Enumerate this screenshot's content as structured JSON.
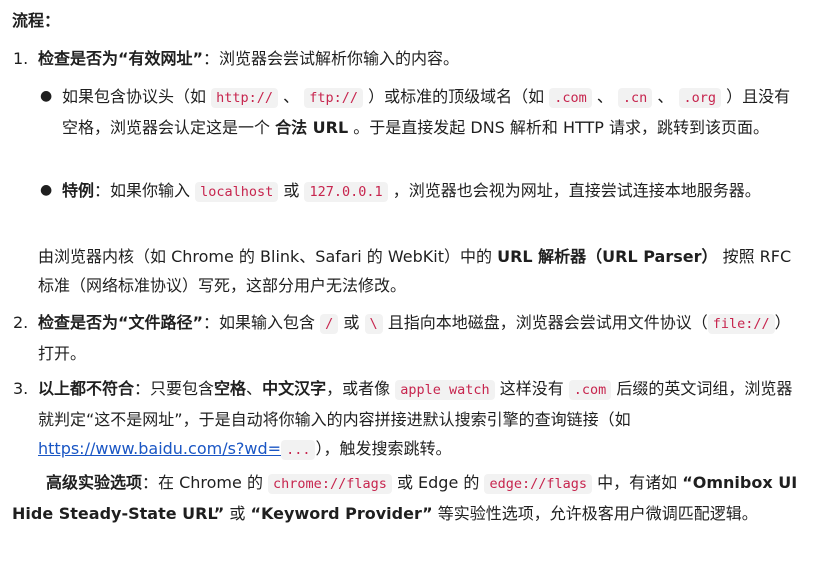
{
  "flow_label": "流程：",
  "items": [
    {
      "number": "1.",
      "title": "检查是否为“有效网址”",
      "desc": "：浏览器会尝试解析你输入的内容。",
      "bullets": [
        {
          "t1": "如果包含协议头（如",
          "c1": "http://",
          "t2": "、",
          "c2": "ftp://",
          "t3": "）或标准的顶级域名（如",
          "c3": ".com",
          "t4": "、",
          "c4": ".cn",
          "t5": "、",
          "c5": ".org",
          "t6": "）且没有空格，浏览器会认定这是一个",
          "b1": "合法 URL",
          "t7": "。于是直接发起 DNS 解析和 HTTP 请求，跳转到该页面。"
        },
        {
          "b1": "特例",
          "t1": "：如果你输入",
          "c1": "localhost",
          "t2": "或",
          "c2": "127.0.0.1",
          "t3": "，浏览器也会视为网址，直接尝试连接本地服务器。"
        }
      ],
      "note": {
        "t1": "由浏览器内核（如 Chrome 的 Blink、Safari 的 WebKit）中的",
        "b1": "URL 解析器（URL Parser）",
        "t2": "按照 RFC 标准（网络标准协议）写死，这部分用户无法修改。"
      }
    },
    {
      "number": "2.",
      "title": "检查是否为“文件路径”",
      "t1": "：如果输入包含",
      "c1": "/",
      "t2": "或",
      "c2": "\\",
      "t3": "且指向本地磁盘，浏览器会尝试用文件协议（",
      "c3": "file://",
      "t4": "）打开。"
    },
    {
      "number": "3.",
      "title": "以上都不符合",
      "t1": "：只要包含",
      "b1": "空格",
      "t2": "、",
      "b2": "中文汉字",
      "t3": "，或者像",
      "c1": "apple watch",
      "t4": "这样没有",
      "c2": ".com",
      "t5": "后缀的英文词组，浏览器就判定“这不是网址”，于是自动将你输入的内容拼接进默认搜索引擎的查询链接（如",
      "link": "https://www.baidu.com/s?wd=",
      "c3": "...",
      "t6": "），触发搜索跳转。"
    }
  ],
  "advanced": {
    "b1": "高级实验选项",
    "t1": "：在 Chrome 的",
    "c1": "chrome://flags",
    "t2": "或 Edge 的",
    "c2": "edge://flags",
    "t3": "中，有诸如",
    "b2": "“Omnibox UI Hide Steady-State URL”",
    "t4": "或",
    "b3": "“Keyword Provider”",
    "t5": "等实验性选项，允许极客用户微调匹配逻辑。"
  }
}
